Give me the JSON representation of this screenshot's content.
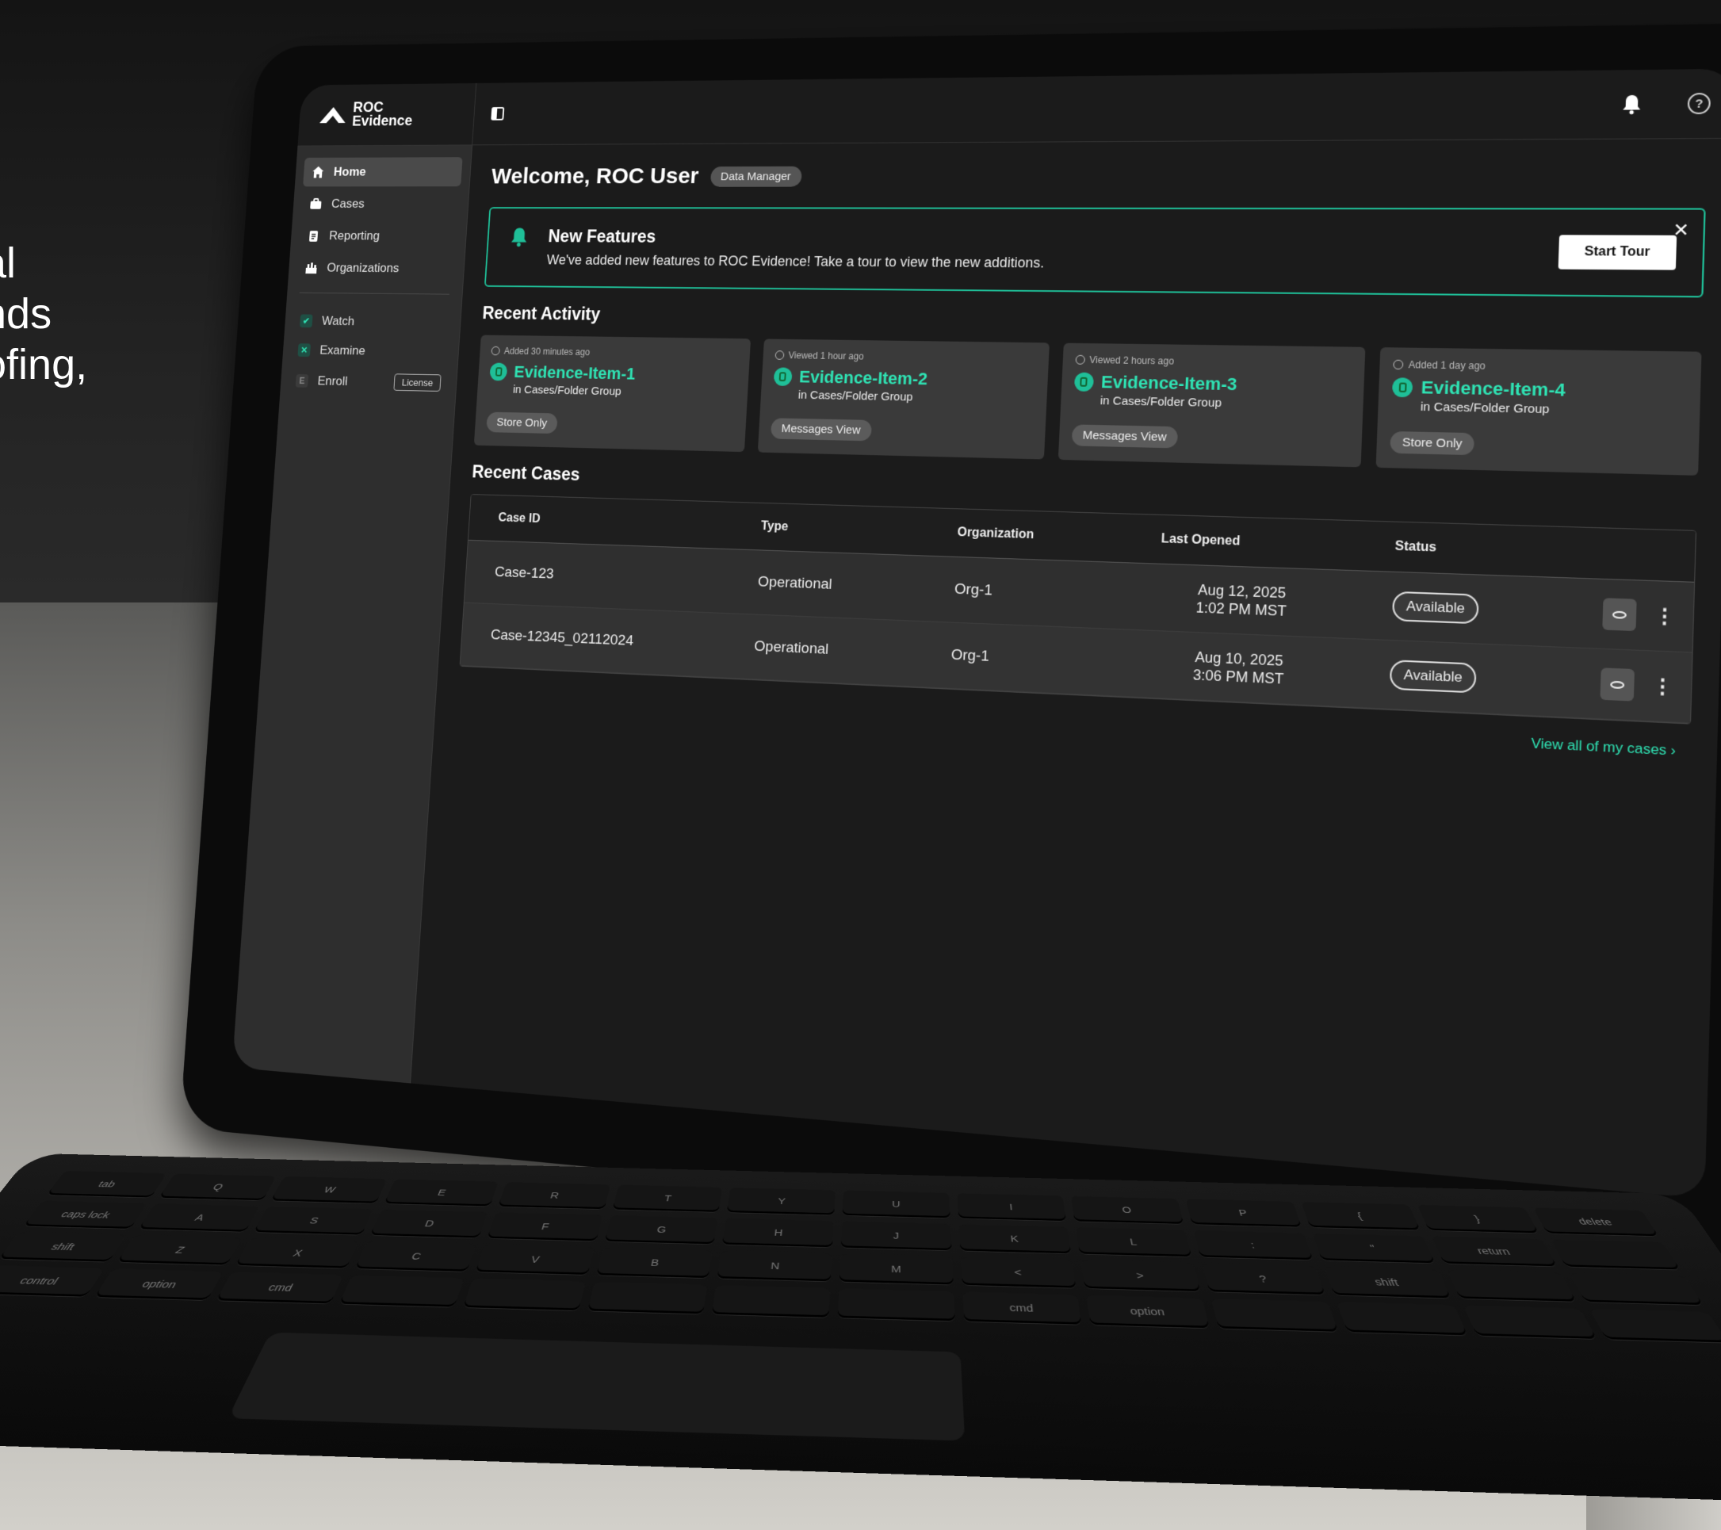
{
  "side_text": [
    "al",
    "nds",
    "ofing,",
    ","
  ],
  "brand": {
    "line1": "ROC",
    "line2": "Evidence"
  },
  "sidebar": {
    "nav": [
      {
        "label": "Home",
        "icon": "home-icon"
      },
      {
        "label": "Cases",
        "icon": "briefcase-icon"
      },
      {
        "label": "Reporting",
        "icon": "clipboard-icon"
      },
      {
        "label": "Organizations",
        "icon": "organization-icon"
      }
    ],
    "apps": [
      {
        "badge": "✔",
        "label": "Watch"
      },
      {
        "badge": "✕",
        "label": "Examine"
      },
      {
        "badge": "E",
        "label": "Enroll",
        "action": "License"
      }
    ]
  },
  "header": {
    "welcome": "Welcome, ROC User",
    "role": "Data Manager"
  },
  "banner": {
    "title": "New Features",
    "text": "We've added new features to ROC Evidence! Take a tour to view the new additions.",
    "button": "Start Tour",
    "close": "✕"
  },
  "recent_activity": {
    "title": "Recent Activity",
    "cards": [
      {
        "meta": "Added 30 minutes ago",
        "name": "Evidence-Item-1",
        "location": "in Cases/Folder Group",
        "tag": "Store Only"
      },
      {
        "meta": "Viewed 1 hour ago",
        "name": "Evidence-Item-2",
        "location": "in Cases/Folder Group",
        "tag": "Messages View"
      },
      {
        "meta": "Viewed 2 hours ago",
        "name": "Evidence-Item-3",
        "location": "in Cases/Folder Group",
        "tag": "Messages View"
      },
      {
        "meta": "Added 1 day ago",
        "name": "Evidence-Item-4",
        "location": "in Cases/Folder Group",
        "tag": "Store Only"
      }
    ]
  },
  "recent_cases": {
    "title": "Recent Cases",
    "columns": [
      "Case ID",
      "Type",
      "Organization",
      "Last Opened",
      "Status"
    ],
    "rows": [
      {
        "id": "Case-123",
        "type": "Operational",
        "org": "Org-1",
        "date": "Aug 12, 2025",
        "time": "1:02 PM MST",
        "status": "Available"
      },
      {
        "id": "Case-12345_02112024",
        "type": "Operational",
        "org": "Org-1",
        "date": "Aug 10, 2025",
        "time": "3:06 PM MST",
        "status": "Available"
      }
    ],
    "view_all": "View all of my cases"
  },
  "keyboard_keys": [
    "tab",
    "Q",
    "W",
    "E",
    "R",
    "T",
    "Y",
    "U",
    "I",
    "O",
    "P",
    "{",
    "}",
    "delete",
    "caps lock",
    "A",
    "S",
    "D",
    "F",
    "G",
    "H",
    "J",
    "K",
    "L",
    ":",
    "\"",
    "return",
    "",
    "shift",
    "Z",
    "X",
    "C",
    "V",
    "B",
    "N",
    "M",
    "<",
    ">",
    "?",
    "shift",
    "",
    "",
    "control",
    "option",
    "cmd",
    "",
    "",
    "",
    "",
    "",
    "cmd",
    "option",
    "",
    "",
    "",
    ""
  ],
  "colors": {
    "accent": "#1fbf98",
    "accent_text": "#2fe3b4",
    "bg": "#1b1b1b",
    "sidebar": "#2e2e2e"
  }
}
